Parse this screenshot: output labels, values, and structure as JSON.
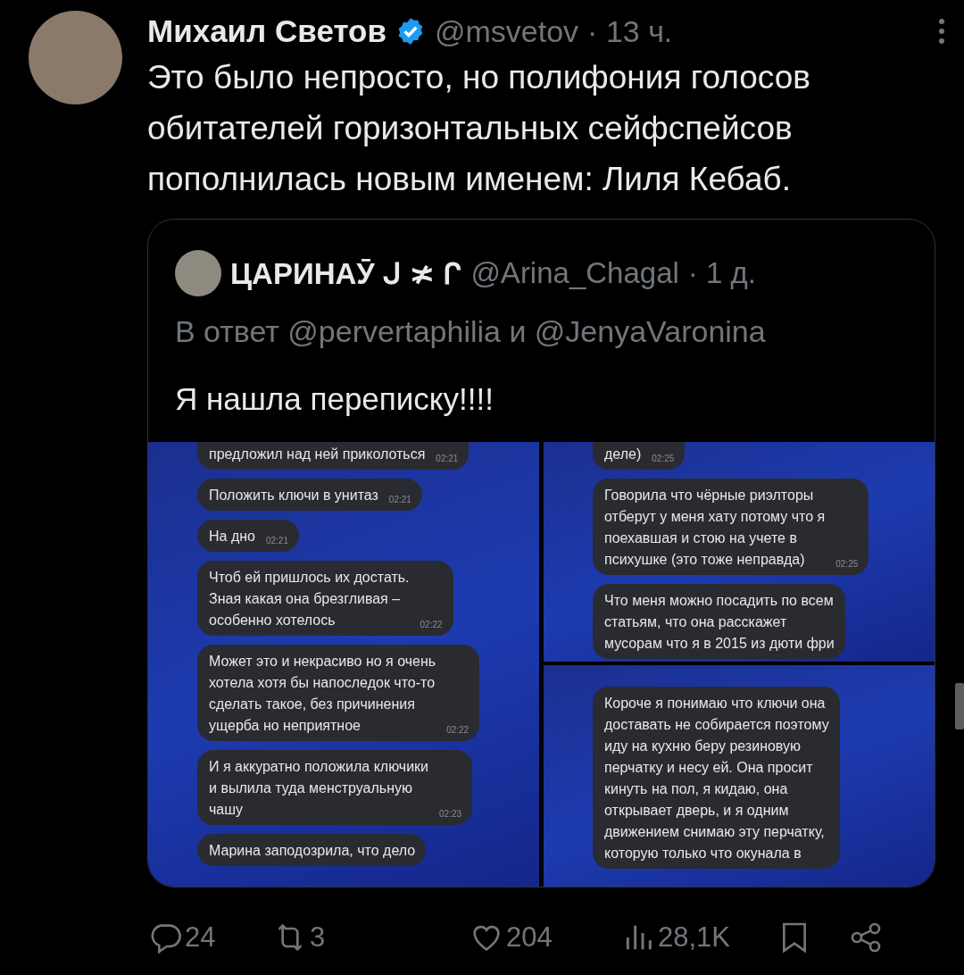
{
  "post": {
    "author": "Михаил Светов",
    "verified": true,
    "handle": "@msvetov",
    "time": "· 13 ч.",
    "text": "Это было непросто, но полифония голосов обитателей горизонтальных сейфспейсов пополнилась новым именем: Лиля Кебаб.",
    "quote": {
      "author": "ЦАРИНАӮ ᒍ ≭ ᒋ",
      "handle": "@Arina_Chagal",
      "time": "· 1 д.",
      "reply_to": "В ответ @pervertaphilia и @JenyaVaronina",
      "text": "Я нашла переписку!!!!",
      "image_panels": [
        {
          "messages": [
            {
              "text": "предложил над ней приколоться",
              "time": "02:21"
            },
            {
              "text": "Положить ключи в унитаз",
              "time": "02:21"
            },
            {
              "text": "На дно",
              "time": "02:21"
            },
            {
              "text": "Чтоб ей пришлось их достать.\nЗная какая она брезгливая –\nособенно хотелось",
              "time": "02:22"
            },
            {
              "text": "Может это и некрасиво но я очень\nхотела хотя бы напоследок что-то\nсделать такое, без причинения\nущерба но неприятное",
              "time": "02:22"
            },
            {
              "text": "И я аккуратно положила ключики\nи вылила туда менструальную\nчашу",
              "time": "02:23"
            },
            {
              "text": "Марина заподозрила, что дело"
            }
          ]
        },
        {
          "messages": [
            {
              "text": "деле)",
              "time": "02:25"
            },
            {
              "text": "Говорила что чёрные риэлторы\nотберут у меня хату потому что я\nпоехавшая и стою на учете в\nпсихушке (это тоже неправда)",
              "time": "02:25"
            },
            {
              "text": "Что меня можно посадить по всем\nстатьям, что она расскажет\nмусорам что я в 2015 из дюти фри"
            }
          ]
        },
        {
          "messages": [
            {
              "text": "Короче я понимаю что ключи она\nдоставать не собирается поэтому\nиду на кухню беру резиновую\nперчатку и несу ей. Она просит\nкинуть на пол, я кидаю, она\nоткрывает дверь, и я одним\nдвижением снимаю эту перчатку,\nкоторую только что окунала в"
            }
          ]
        }
      ]
    },
    "actions": [
      {
        "kind": "reply",
        "count": "24"
      },
      {
        "kind": "repost",
        "count": "3"
      },
      {
        "kind": "like",
        "count": "204"
      },
      {
        "kind": "views",
        "count": "28,1K"
      },
      {
        "kind": "bookmark"
      },
      {
        "kind": "share"
      }
    ]
  }
}
